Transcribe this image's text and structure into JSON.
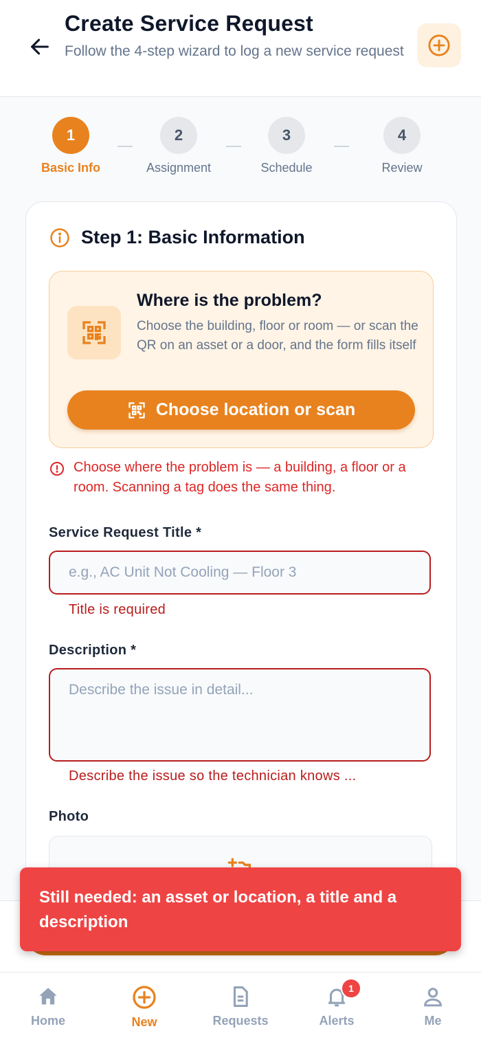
{
  "header": {
    "title": "Create Service Request",
    "subtitle": "Follow the 4-step wizard to log a new service request",
    "back_icon": "arrow-left-icon",
    "action_icon": "plus-circle-icon"
  },
  "stepper": {
    "steps": [
      {
        "number": "1",
        "label": "Basic Info",
        "active": true
      },
      {
        "number": "2",
        "label": "Assignment",
        "active": false
      },
      {
        "number": "3",
        "label": "Schedule",
        "active": false
      },
      {
        "number": "4",
        "label": "Review",
        "active": false
      }
    ]
  },
  "form": {
    "section_title": "Step 1: Basic Information",
    "location": {
      "title": "Where is the problem?",
      "description": "Choose the building, floor or room — or scan the QR on an asset or a door, and the form fills itself",
      "button_label": "Choose location or scan",
      "error": "Choose where the problem is — a building, a floor or a room. Scanning a tag does the same thing."
    },
    "title_field": {
      "label": "Service Request Title *",
      "value": "",
      "placeholder": "e.g., AC Unit Not Cooling — Floor 3",
      "error": "Title is required"
    },
    "description_field": {
      "label": "Description *",
      "value": "",
      "placeholder": "Describe the issue in detail...",
      "error": "Describe the issue so the technician knows ..."
    },
    "photo_field": {
      "label": "Photo"
    }
  },
  "toast": {
    "message": "Still needed: an asset or location, a title and a description"
  },
  "tabbar": {
    "tabs": [
      {
        "label": "Home",
        "icon": "home-icon"
      },
      {
        "label": "New",
        "icon": "plus-circle-icon"
      },
      {
        "label": "Requests",
        "icon": "document-icon"
      },
      {
        "label": "Alerts",
        "icon": "bell-icon",
        "badge": "1"
      },
      {
        "label": "Me",
        "icon": "user-icon"
      }
    ]
  },
  "colors": {
    "accent": "#e8821e",
    "error": "#b91c1c",
    "toast": "#ef4444"
  }
}
